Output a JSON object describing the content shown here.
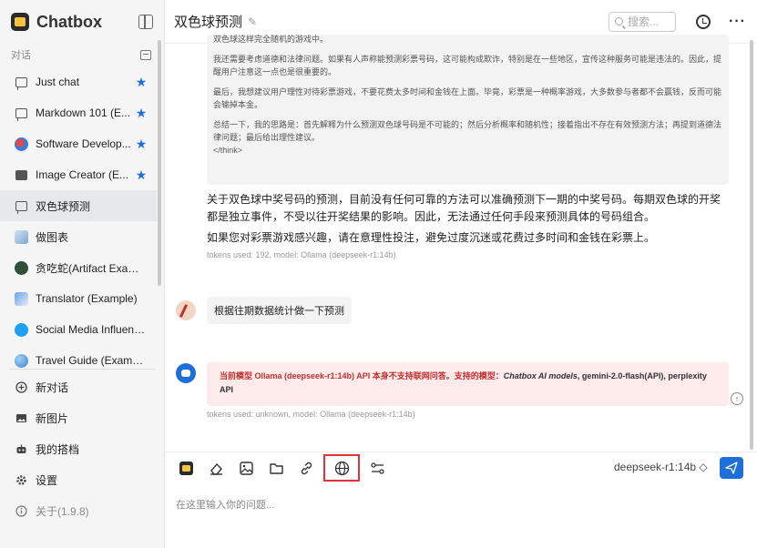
{
  "app": {
    "name": "Chatbox"
  },
  "sidebar": {
    "section_label": "对话",
    "items": [
      {
        "label": "Just chat",
        "icon": "chat-icon",
        "starred": true
      },
      {
        "label": "Markdown 101 (E...",
        "icon": "chat-icon",
        "starred": true
      },
      {
        "label": "Software Develop...",
        "icon": "developer-avatar",
        "starred": true
      },
      {
        "label": "Image Creator (E...",
        "icon": "image-creator-icon",
        "starred": true
      },
      {
        "label": "双色球预测",
        "icon": "chat-icon",
        "starred": false,
        "active": true
      },
      {
        "label": "做图表",
        "icon": "chart-avatar",
        "starred": false
      },
      {
        "label": "贪吃蛇(Artifact Example)",
        "icon": "snake-avatar",
        "starred": false
      },
      {
        "label": "Translator (Example)",
        "icon": "translator-avatar",
        "starred": false
      },
      {
        "label": "Social Media Influence...",
        "icon": "twitter-avatar",
        "starred": false
      },
      {
        "label": "Travel Guide (Example)",
        "icon": "globe-avatar",
        "starred": false
      }
    ],
    "bottom": {
      "new_chat": "新对话",
      "new_image": "新图片",
      "my_partners": "我的搭档",
      "settings": "设置",
      "about": "关于(1.9.8)"
    }
  },
  "header": {
    "title": "双色球预测",
    "search_placeholder": "搜索..."
  },
  "messages": {
    "think_lines": [
      "双色球这样完全随机的游戏中。",
      "我还需要考虑道德和法律问题。如果有人声称能预测彩票号码，这可能构成欺诈，特别是在一些地区，宣传这种服务可能是违法的。因此，提醒用户注意这一点也是很重要的。",
      "最后，我想建议用户理性对待彩票游戏，不要花费太多时间和金钱在上面。毕竟，彩票是一种概率游戏，大多数参与者都不会赢钱，反而可能会输掉本金。",
      "总结一下，我的思路是：首先解释为什么预测双色球号码是不可能的；然后分析概率和随机性；接着指出不存在有效预测方法；再提到道德法律问题；最后给出理性建议。",
      "</think>"
    ],
    "answer_paragraphs": [
      "关于双色球中奖号码的预测，目前没有任何可靠的方法可以准确预测下一期的中奖号码。每期双色球的开奖都是独立事件，不受以往开奖结果的影响。因此，无法通过任何手段来预测具体的号码组合。",
      "如果您对彩票游戏感兴趣，请在意理性投注，避免过度沉迷或花费过多时间和金钱在彩票上。"
    ],
    "answer_meta": "tokens used: 192, model: Ollama (deepseek-r1:14b)",
    "user_message": "根据往期数据统计做一下预测",
    "error_prefix": "当前模型 Ollama (deepseek-r1:14b) API 本身不支持联网问答。支持的模型：",
    "error_models_italic": "Chatbox AI models",
    "error_models_rest": ", gemini-2.0-flash(API), perplexity API",
    "error_meta": "tokens used: unknown, model: Ollama (deepseek-r1:14b)"
  },
  "composer": {
    "model": "deepseek-r1:14b ◇",
    "placeholder": "在这里输入你的问题..."
  },
  "colors": {
    "accent": "#1e6fd9",
    "error_bg": "#fdeaea",
    "error_text": "#c0312f",
    "highlight": "#e0333a"
  }
}
